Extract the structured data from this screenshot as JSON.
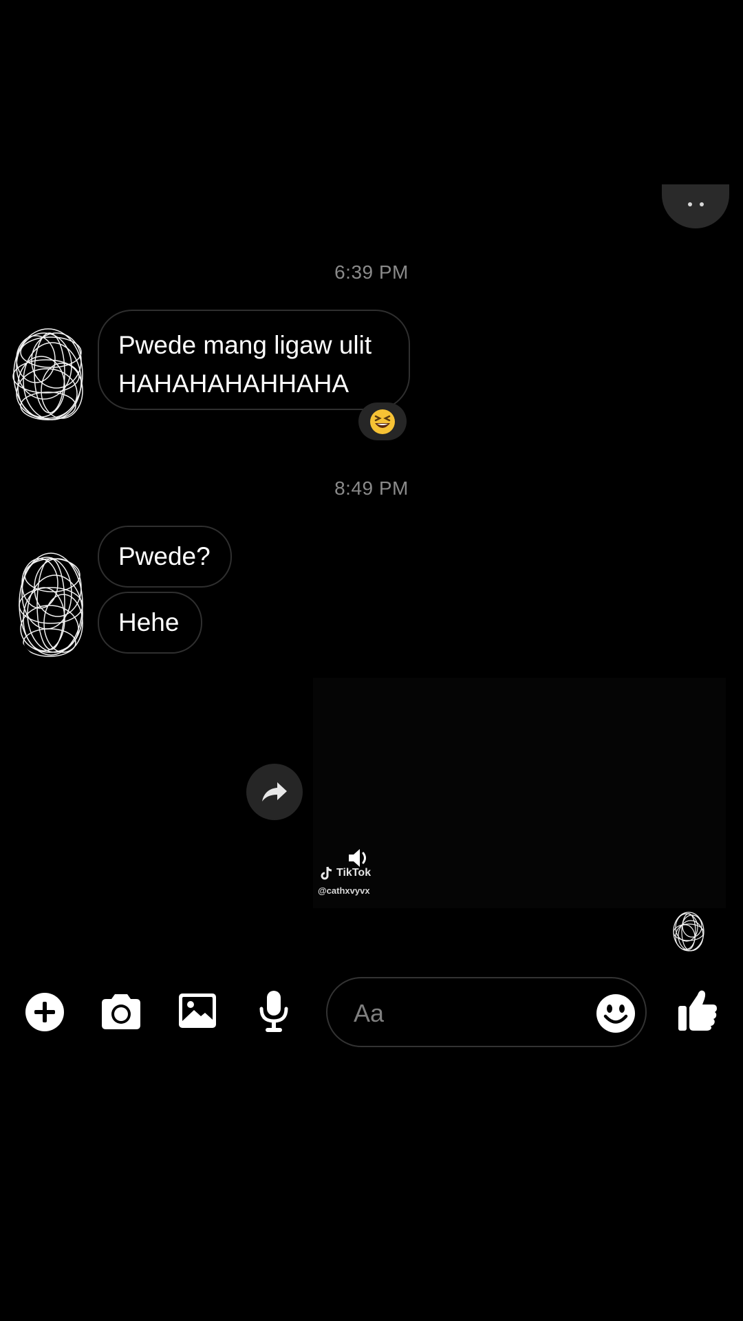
{
  "thread": {
    "groups": [
      {
        "timestamp": "6:39 PM",
        "messages": [
          {
            "lines": [
              "Pwede mang ligaw ulit",
              "HAHAHAHAHHAHA"
            ],
            "reaction": "😆"
          }
        ]
      },
      {
        "timestamp": "8:49 PM",
        "messages": [
          {
            "text": "Pwede?"
          },
          {
            "text": "Hehe"
          }
        ]
      }
    ],
    "shared_video": {
      "source": "TikTok",
      "handle": "@cathxvyvx"
    }
  },
  "composer": {
    "placeholder": "Aa",
    "icons": [
      "plus-icon",
      "camera-icon",
      "image-icon",
      "microphone-icon",
      "emoji-icon",
      "thumbs-up-icon"
    ]
  },
  "colors": {
    "background": "#000000",
    "bubble_border": "#2f2f2f",
    "timestamp": "#8a8a8a"
  }
}
